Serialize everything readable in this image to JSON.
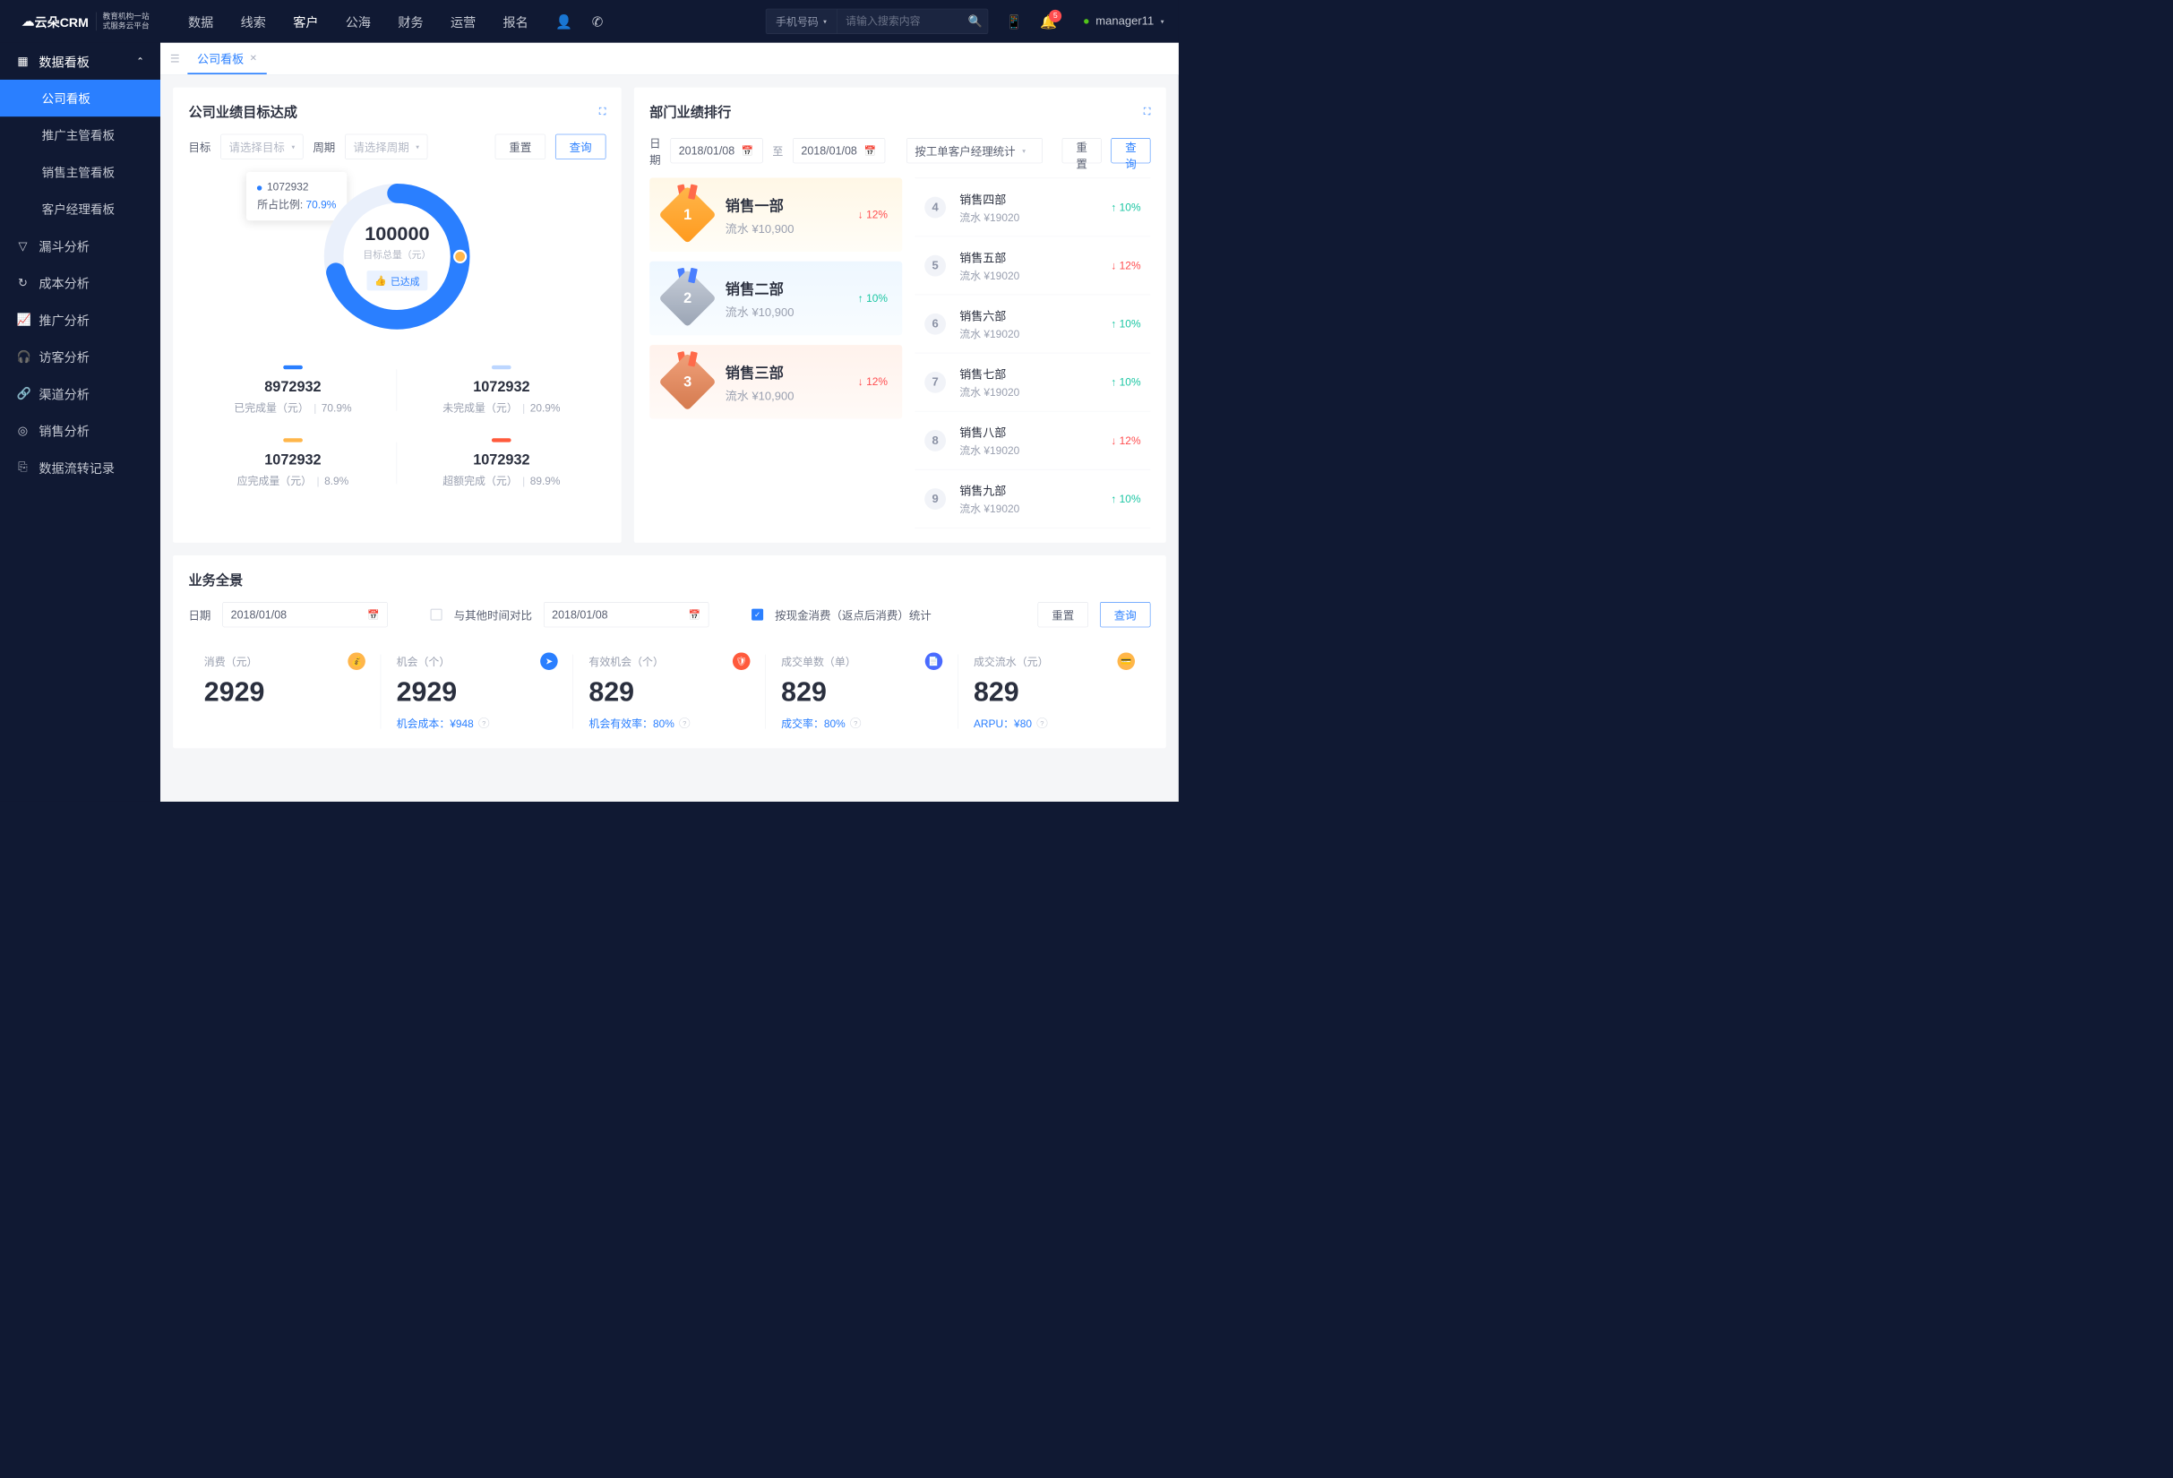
{
  "brand": {
    "name": "云朵CRM",
    "sub1": "教育机构一站",
    "sub2": "式服务云平台"
  },
  "topnav": {
    "items": [
      "数据",
      "线索",
      "客户",
      "公海",
      "财务",
      "运营",
      "报名"
    ],
    "active": 2
  },
  "search": {
    "category": "手机号码",
    "placeholder": "请输入搜索内容"
  },
  "notif": {
    "count": "5"
  },
  "user": {
    "name": "manager11"
  },
  "sidebar": {
    "group": {
      "label": "数据看板",
      "expanded": true,
      "items": [
        "公司看板",
        "推广主管看板",
        "销售主管看板",
        "客户经理看板"
      ],
      "active": 0
    },
    "items": [
      {
        "icon": "filter",
        "label": "漏斗分析"
      },
      {
        "icon": "cycle",
        "label": "成本分析"
      },
      {
        "icon": "chart",
        "label": "推广分析"
      },
      {
        "icon": "visitor",
        "label": "访客分析"
      },
      {
        "icon": "channel",
        "label": "渠道分析"
      },
      {
        "icon": "sales",
        "label": "销售分析"
      },
      {
        "icon": "flow",
        "label": "数据流转记录"
      }
    ]
  },
  "tab": {
    "label": "公司看板"
  },
  "card1": {
    "title": "公司业绩目标达成",
    "target_label": "目标",
    "target_ph": "请选择目标",
    "period_label": "周期",
    "period_ph": "请选择周期",
    "reset": "重置",
    "query": "查询",
    "donut": {
      "total": "100000",
      "total_label": "目标总量（元）",
      "status": "已达成",
      "tooltip_val": "1072932",
      "tooltip_lbl": "所占比例:",
      "tooltip_pct": "70.9%",
      "pct": 70.9
    },
    "stats": [
      {
        "color": "#2a7fff",
        "num": "8972932",
        "lbl": "已完成量（元）",
        "pct": "70.9%"
      },
      {
        "color": "#bcd6ff",
        "num": "1072932",
        "lbl": "未完成量（元）",
        "pct": "20.9%"
      },
      {
        "color": "#ffb64a",
        "num": "1072932",
        "lbl": "应完成量（元）",
        "pct": "8.9%"
      },
      {
        "color": "#ff5a3c",
        "num": "1072932",
        "lbl": "超额完成（元）",
        "pct": "89.9%"
      }
    ]
  },
  "card2": {
    "title": "部门业绩排行",
    "date_label": "日期",
    "date_from": "2018/01/08",
    "date_to": "2018/01/08",
    "to": "至",
    "group_by": "按工单客户经理统计",
    "reset": "重置",
    "query": "查询",
    "top3": [
      {
        "rank": "1",
        "name": "销售一部",
        "sub": "流水 ¥10,900",
        "trend": "down",
        "pct": "12%"
      },
      {
        "rank": "2",
        "name": "销售二部",
        "sub": "流水 ¥10,900",
        "trend": "up",
        "pct": "10%"
      },
      {
        "rank": "3",
        "name": "销售三部",
        "sub": "流水 ¥10,900",
        "trend": "down",
        "pct": "12%"
      }
    ],
    "rest": [
      {
        "rank": "4",
        "name": "销售四部",
        "sub": "流水 ¥19020",
        "trend": "up",
        "pct": "10%"
      },
      {
        "rank": "5",
        "name": "销售五部",
        "sub": "流水 ¥19020",
        "trend": "down",
        "pct": "12%"
      },
      {
        "rank": "6",
        "name": "销售六部",
        "sub": "流水 ¥19020",
        "trend": "up",
        "pct": "10%"
      },
      {
        "rank": "7",
        "name": "销售七部",
        "sub": "流水 ¥19020",
        "trend": "up",
        "pct": "10%"
      },
      {
        "rank": "8",
        "name": "销售八部",
        "sub": "流水 ¥19020",
        "trend": "down",
        "pct": "12%"
      },
      {
        "rank": "9",
        "name": "销售九部",
        "sub": "流水 ¥19020",
        "trend": "up",
        "pct": "10%"
      }
    ]
  },
  "card3": {
    "title": "业务全景",
    "date_label": "日期",
    "date1": "2018/01/08",
    "compare": "与其他时间对比",
    "date2": "2018/01/08",
    "checkbox": "按现金消费（返点后消费）统计",
    "reset": "重置",
    "query": "查询",
    "stats": [
      {
        "lbl": "消费（元）",
        "icon_bg": "#ffb64a",
        "num": "2929",
        "sub": ""
      },
      {
        "lbl": "机会（个）",
        "icon_bg": "#2a7fff",
        "num": "2929",
        "sub": "机会成本：¥948"
      },
      {
        "lbl": "有效机会（个）",
        "icon_bg": "#ff5a3c",
        "num": "829",
        "sub": "机会有效率：80%"
      },
      {
        "lbl": "成交单数（单）",
        "icon_bg": "#4a6aff",
        "num": "829",
        "sub": "成交率：80%"
      },
      {
        "lbl": "成交流水（元）",
        "icon_bg": "#ffb64a",
        "num": "829",
        "sub": "ARPU：¥80"
      }
    ]
  },
  "chart_data": {
    "type": "pie",
    "title": "公司业绩目标达成",
    "total": 100000,
    "total_label": "目标总量（元）",
    "series": [
      {
        "name": "已完成量（元）",
        "value": 8972932,
        "pct": 70.9,
        "color": "#2a7fff"
      },
      {
        "name": "未完成量（元）",
        "value": 1072932,
        "pct": 20.9,
        "color": "#bcd6ff"
      },
      {
        "name": "应完成量（元）",
        "value": 1072932,
        "pct": 8.9,
        "color": "#ffb64a"
      },
      {
        "name": "超额完成（元）",
        "value": 1072932,
        "pct": 89.9,
        "color": "#ff5a3c"
      }
    ]
  }
}
